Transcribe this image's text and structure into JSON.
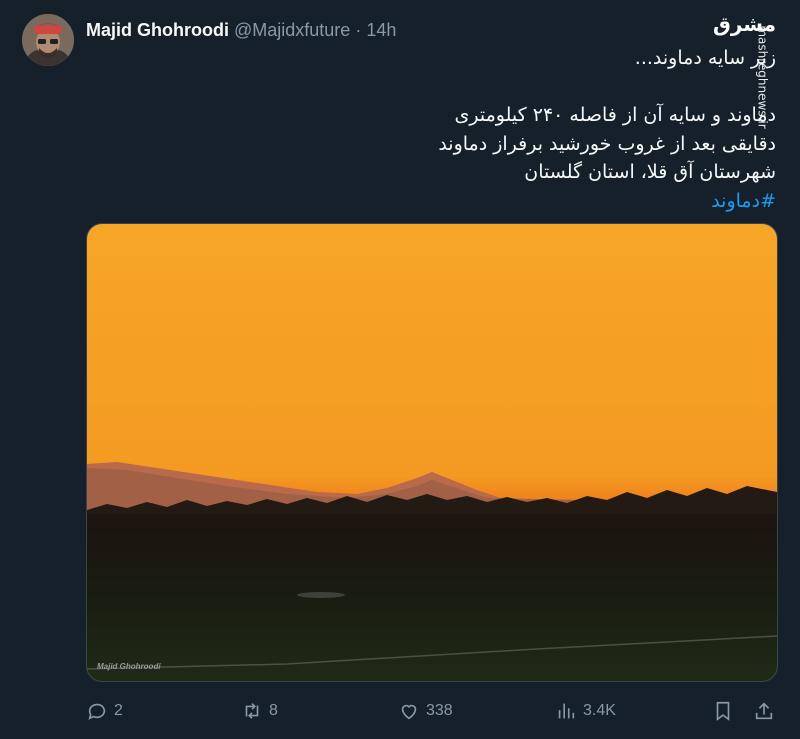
{
  "tweet": {
    "author_name": "Majid Ghohroodi",
    "author_handle": "@Majidxfuture",
    "separator": "·",
    "time": "14h",
    "text_lines": [
      "زیر سایه دماوند...",
      "",
      "دماوند و سایه آن از فاصله ۲۴۰ کیلومتری",
      "دقایقی بعد از غروب خورشید برفراز دماوند",
      "شهرستان آق قلا، استان گلستان"
    ],
    "hashtag": "#دماوند",
    "media": {
      "description_icon": "sunset-mountain-photo",
      "credit": "Majid Ghohroodi"
    },
    "actions": {
      "replies": "2",
      "retweets": "8",
      "likes": "338",
      "views": "3.4K"
    }
  },
  "watermark": {
    "logo": "مشرق",
    "site": "mashreghnews.ir"
  },
  "colors": {
    "background": "#15202b",
    "text": "#f7f9f9",
    "muted": "#8b98a5",
    "link": "#1d9bf0"
  }
}
